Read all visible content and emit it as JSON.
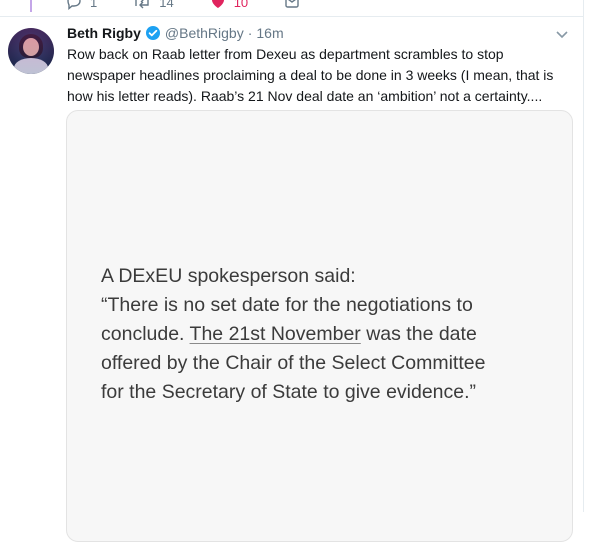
{
  "prev_tweet": {
    "reply_count": "1",
    "retweet_count": "14",
    "like_count": "10"
  },
  "tweet": {
    "author_name": "Beth Rigby",
    "handle": "@BethRigby",
    "separator": "·",
    "time": "16m",
    "text": "Row back on Raab letter from Dexeu as department scrambles to stop newspaper headlines proclaiming a deal to be done in 3 weeks (I mean, that is how his letter reads). Raab’s 21 Nov deal date an ‘ambition’ not a certainty...."
  },
  "card": {
    "line1": "A DExEU spokesperson said:",
    "line2": "“There is no set date for the negotiations to",
    "line3_pre": "conclude. ",
    "line3_underlined": "The 21st November",
    "line3_post": " was the date",
    "line4": "offered by the Chair of the Select Committee",
    "line5": "for the Secretary of State to give evidence.”"
  },
  "colors": {
    "verified_blue": "#1da1f2",
    "like_pink": "#e0245e",
    "thread_line": "#c4a6e8"
  },
  "icons": {
    "reply": "reply-icon",
    "retweet": "retweet-icon",
    "like": "heart-icon",
    "dm": "mail-icon",
    "verified": "verified-badge-icon",
    "caret": "chevron-down-icon"
  }
}
